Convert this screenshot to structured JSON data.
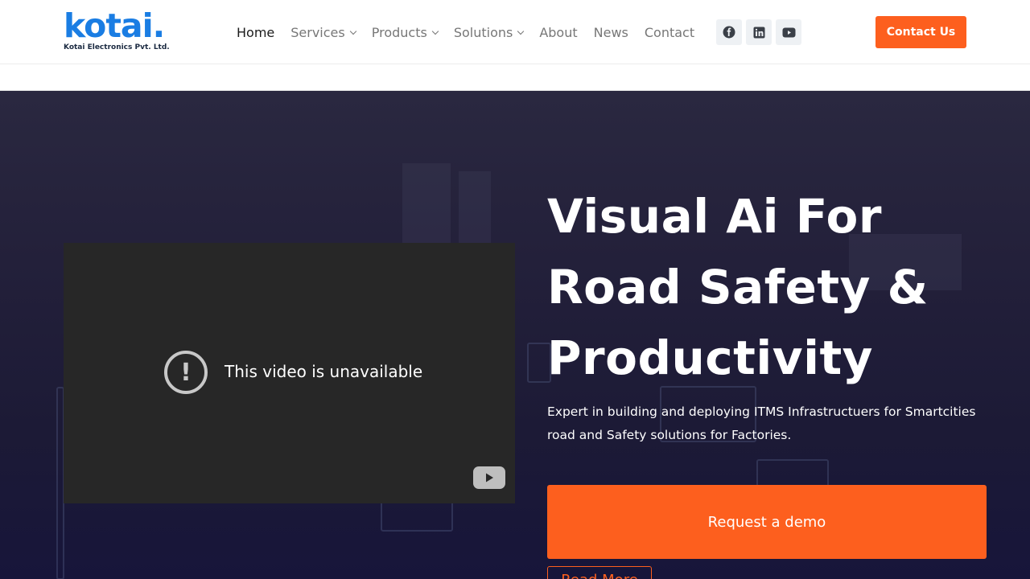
{
  "brand": {
    "name": "kotai.",
    "tagline": "Kotai Electronics Pvt. Ltd.",
    "color": "#1a7de3"
  },
  "nav": {
    "items": [
      {
        "label": "Home"
      },
      {
        "label": "Services"
      },
      {
        "label": "Products"
      },
      {
        "label": "Solutions"
      },
      {
        "label": "About"
      },
      {
        "label": "News"
      },
      {
        "label": "Contact"
      }
    ]
  },
  "socials": {
    "icons": [
      "facebook-icon",
      "linkedin-icon",
      "youtube-icon"
    ]
  },
  "header_cta": {
    "label": "Contact Us",
    "color": "#fd5f1e"
  },
  "video": {
    "message": "This video is unavailable"
  },
  "hero": {
    "title_line1": "Visual Ai For",
    "title_line2": "Road Safety &",
    "title_line3": "Productivity",
    "description": "Expert in building and deploying ITMS Infrastructuers for Smartcities road and Safety solutions for Factories.",
    "demo_label": "Request a demo",
    "read_more_label": "Read More"
  }
}
